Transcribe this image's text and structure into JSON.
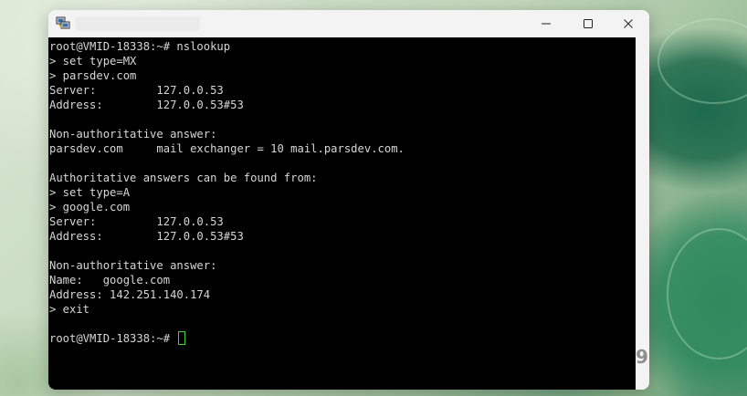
{
  "window": {
    "controls": {
      "minimize_icon": "minimize-icon",
      "maximize_icon": "maximize-icon",
      "close_icon": "close-icon"
    }
  },
  "terminal": {
    "lines": [
      "root@VMID-18338:~# nslookup",
      "> set type=MX",
      "> parsdev.com",
      "Server:         127.0.0.53",
      "Address:        127.0.0.53#53",
      "",
      "Non-authoritative answer:",
      "parsdev.com     mail exchanger = 10 mail.parsdev.com.",
      "",
      "Authoritative answers can be found from:",
      "> set type=A",
      "> google.com",
      "Server:         127.0.0.53",
      "Address:        127.0.0.53#53",
      "",
      "Non-authoritative answer:",
      "Name:   google.com",
      "Address: 142.251.140.174",
      "> exit",
      "",
      "root@VMID-18338:~# "
    ],
    "cursor_color": "#3fd13f",
    "text_color": "#d6d6d6",
    "background_color": "#000000"
  }
}
